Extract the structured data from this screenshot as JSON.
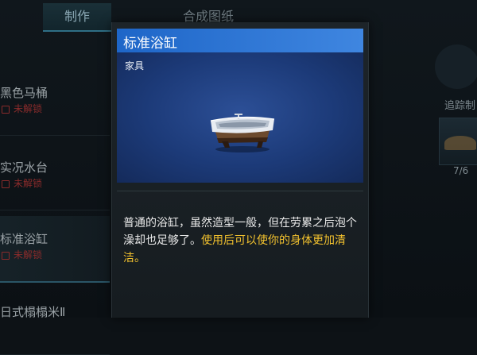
{
  "tabs": [
    {
      "label": "制作",
      "active": true
    },
    {
      "label": "合成图纸",
      "active": false
    }
  ],
  "left_list": [
    {
      "name": "黑色马桶",
      "status": "未解锁"
    },
    {
      "name": "实况水台",
      "status": "未解锁"
    },
    {
      "name": "标准浴缸",
      "status": "未解锁"
    },
    {
      "name": "日式榻榻米Ⅱ",
      "status": ""
    }
  ],
  "right_panel": {
    "track_label": "追踪制",
    "count": "7/6"
  },
  "detail": {
    "title": "标准浴缸",
    "category": "家具",
    "description_plain": "普通的浴缸，虽然造型一般，但在劳累之后泡个澡却也足够了。",
    "description_highlight": "使用后可以使你的身体更加清洁。"
  },
  "colors": {
    "header_blue": "#2f78d8",
    "highlight_yellow": "#f2c12e",
    "locked_red": "#8a2b2b"
  },
  "icons": {
    "lock": "lock-icon",
    "item": "bathtub-icon"
  }
}
